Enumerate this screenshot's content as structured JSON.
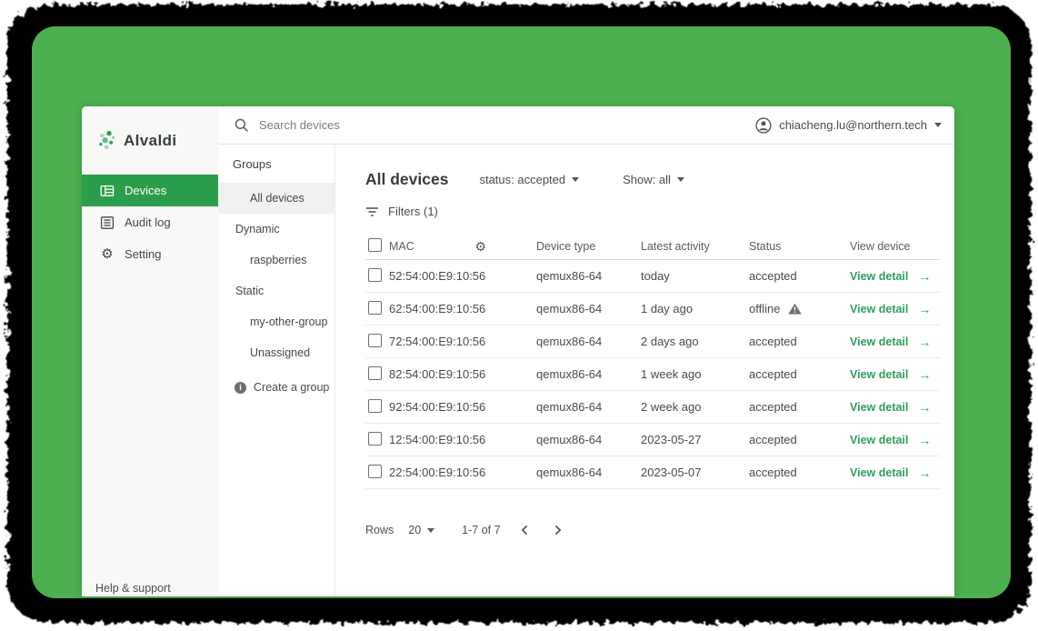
{
  "colors": {
    "accent_green": "#2b9e4b",
    "screen_green": "#4caf50",
    "link_green": "#2f9e5c"
  },
  "topbar": {
    "search_placeholder": "Search devices",
    "account_email": "chiacheng.lu@northern.tech"
  },
  "sidebar": {
    "logo_text": "Alvaldi",
    "items": [
      {
        "label": "Devices",
        "icon": "devices-icon",
        "active": true
      },
      {
        "label": "Audit log",
        "icon": "audit-log-icon",
        "active": false
      },
      {
        "label": "Setting",
        "icon": "gear-icon",
        "active": false
      }
    ],
    "footer_link": "Help & support"
  },
  "groups_panel": {
    "title": "Groups",
    "items": [
      {
        "label": "All devices",
        "kind": "group",
        "selected": true
      },
      {
        "label": "Dynamic",
        "kind": "section"
      },
      {
        "label": "raspberries",
        "kind": "group"
      },
      {
        "label": "Static",
        "kind": "section"
      },
      {
        "label": "my-other-group",
        "kind": "group"
      },
      {
        "label": "Unassigned",
        "kind": "group"
      }
    ],
    "create_group": {
      "label": "Create a group",
      "icon": "info-icon"
    }
  },
  "main": {
    "title": "All devices",
    "status_filter": "status: accepted",
    "show_filter": "Show: all",
    "filters_label": "Filters (1)",
    "filters_icon": "filter-icon",
    "table_settings_icon": "gear-icon",
    "table": {
      "columns": [
        "MAC",
        "Device type",
        "Latest activity",
        "Status",
        "View device"
      ],
      "rows": [
        {
          "mac": "52:54:00:E9:10:56",
          "device_type": "qemux86-64",
          "latest_activity": "today",
          "status": "accepted",
          "warning": false,
          "action": "View detail"
        },
        {
          "mac": "62:54:00:E9:10:56",
          "device_type": "qemux86-64",
          "latest_activity": "1 day ago",
          "status": "offline",
          "warning": true,
          "action": "View detail"
        },
        {
          "mac": "72:54:00:E9:10:56",
          "device_type": "qemux86-64",
          "latest_activity": "2 days ago",
          "status": "accepted",
          "warning": false,
          "action": "View detail"
        },
        {
          "mac": "82:54:00:E9:10:56",
          "device_type": "qemux86-64",
          "latest_activity": "1 week ago",
          "status": "accepted",
          "warning": false,
          "action": "View detail"
        },
        {
          "mac": "92:54:00:E9:10:56",
          "device_type": "qemux86-64",
          "latest_activity": "2 week ago",
          "status": "accepted",
          "warning": false,
          "action": "View detail"
        },
        {
          "mac": "12:54:00:E9:10:56",
          "device_type": "qemux86-64",
          "latest_activity": "2023-05-27",
          "status": "accepted",
          "warning": false,
          "action": "View detail"
        },
        {
          "mac": "22:54:00:E9:10:56",
          "device_type": "qemux86-64",
          "latest_activity": "2023-05-07",
          "status": "accepted",
          "warning": false,
          "action": "View detail"
        }
      ]
    },
    "pagination": {
      "rows_label": "Rows",
      "rows_per_page": "20",
      "range": "1-7 of 7"
    }
  }
}
